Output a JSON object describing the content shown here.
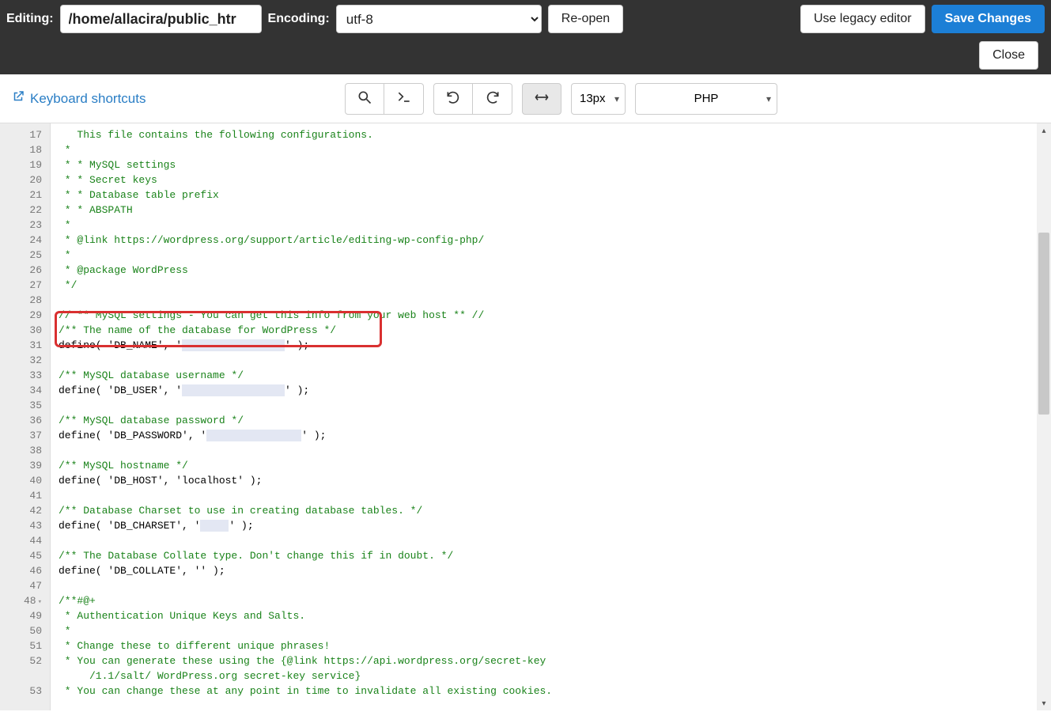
{
  "header": {
    "editing_label": "Editing:",
    "file_path": "/home/allacira/public_htr",
    "encoding_label": "Encoding:",
    "encoding_value": "utf-8",
    "reopen": "Re-open",
    "legacy": "Use legacy editor",
    "save": "Save Changes",
    "close": "Close"
  },
  "toolbar": {
    "keyboard_shortcuts": "Keyboard shortcuts",
    "font_size": "13px",
    "language": "PHP"
  },
  "editor": {
    "first_line_number": 17,
    "lines": [
      {
        "n": 17,
        "cls": "c-cm",
        "text": "   This file contains the following configurations."
      },
      {
        "n": 18,
        "cls": "c-cm",
        "text": " *"
      },
      {
        "n": 19,
        "cls": "c-cm",
        "text": " * * MySQL settings"
      },
      {
        "n": 20,
        "cls": "c-cm",
        "text": " * * Secret keys"
      },
      {
        "n": 21,
        "cls": "c-cm",
        "text": " * * Database table prefix"
      },
      {
        "n": 22,
        "cls": "c-cm",
        "text": " * * ABSPATH"
      },
      {
        "n": 23,
        "cls": "c-cm",
        "text": " *"
      },
      {
        "n": 24,
        "cls": "c-cm",
        "text": " * @link https://wordpress.org/support/article/editing-wp-config-php/"
      },
      {
        "n": 25,
        "cls": "c-cm",
        "text": " *"
      },
      {
        "n": 26,
        "cls": "c-cm",
        "text": " * @package WordPress"
      },
      {
        "n": 27,
        "cls": "c-cm",
        "text": " */"
      },
      {
        "n": 28,
        "cls": "",
        "text": ""
      },
      {
        "n": 29,
        "cls": "c-cm",
        "text": "// ** MySQL settings - You can get this info from your web host ** //"
      },
      {
        "n": 30,
        "cls": "c-cm",
        "text": "/** The name of the database for WordPress */"
      },
      {
        "n": 31,
        "cls": "",
        "text": "define( 'DB_NAME', '",
        "redacted_w": 130,
        "tail": "' );"
      },
      {
        "n": 32,
        "cls": "",
        "text": ""
      },
      {
        "n": 33,
        "cls": "c-cm",
        "text": "/** MySQL database username */"
      },
      {
        "n": 34,
        "cls": "",
        "text": "define( 'DB_USER', '",
        "redacted_w": 130,
        "tail": "' );"
      },
      {
        "n": 35,
        "cls": "",
        "text": ""
      },
      {
        "n": 36,
        "cls": "c-cm",
        "text": "/** MySQL database password */"
      },
      {
        "n": 37,
        "cls": "",
        "text": "define( 'DB_PASSWORD', '",
        "redacted_w": 120,
        "tail": "' );"
      },
      {
        "n": 38,
        "cls": "",
        "text": ""
      },
      {
        "n": 39,
        "cls": "c-cm",
        "text": "/** MySQL hostname */"
      },
      {
        "n": 40,
        "cls": "",
        "text": "define( 'DB_HOST', 'localhost' );"
      },
      {
        "n": 41,
        "cls": "",
        "text": ""
      },
      {
        "n": 42,
        "cls": "c-cm",
        "text": "/** Database Charset to use in creating database tables. */"
      },
      {
        "n": 43,
        "cls": "",
        "text": "define( 'DB_CHARSET', '",
        "redacted_w": 36,
        "tail": "' );"
      },
      {
        "n": 44,
        "cls": "",
        "text": ""
      },
      {
        "n": 45,
        "cls": "c-cm",
        "text": "/** The Database Collate type. Don't change this if in doubt. */"
      },
      {
        "n": 46,
        "cls": "",
        "text": "define( 'DB_COLLATE', '' );"
      },
      {
        "n": 47,
        "cls": "",
        "text": ""
      },
      {
        "n": 48,
        "cls": "c-cm",
        "text": "/**#@+",
        "fold": true
      },
      {
        "n": 49,
        "cls": "c-cm",
        "text": " * Authentication Unique Keys and Salts."
      },
      {
        "n": 50,
        "cls": "c-cm",
        "text": " *"
      },
      {
        "n": 51,
        "cls": "c-cm",
        "text": " * Change these to different unique phrases!"
      },
      {
        "n": 52,
        "cls": "c-cm",
        "text": " * You can generate these using the {@link https://api.wordpress.org/secret-key"
      },
      {
        "n": "",
        "cls": "c-cm",
        "text": "     /1.1/salt/ WordPress.org secret-key service}"
      },
      {
        "n": 53,
        "cls": "c-cm",
        "text": " * You can change these at any point in time to invalidate all existing cookies."
      }
    ]
  }
}
